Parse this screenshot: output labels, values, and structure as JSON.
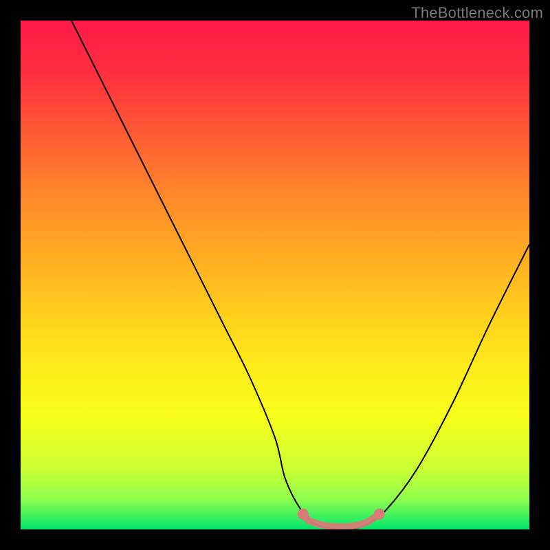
{
  "watermark": "TheBottleneck.com",
  "gradient": {
    "stops": [
      {
        "offset": 0.0,
        "color": "#ff1a47"
      },
      {
        "offset": 0.1,
        "color": "#ff2e3f"
      },
      {
        "offset": 0.22,
        "color": "#ff5a33"
      },
      {
        "offset": 0.35,
        "color": "#ff8a2a"
      },
      {
        "offset": 0.5,
        "color": "#ffb81f"
      },
      {
        "offset": 0.65,
        "color": "#ffe41a"
      },
      {
        "offset": 0.78,
        "color": "#f7ff1a"
      },
      {
        "offset": 0.88,
        "color": "#ccff33"
      },
      {
        "offset": 0.94,
        "color": "#8fff4d"
      },
      {
        "offset": 1.0,
        "color": "#00e56a"
      }
    ]
  },
  "chart_data": {
    "type": "line",
    "title": "",
    "xlabel": "",
    "ylabel": "",
    "xlim": [
      0,
      100
    ],
    "ylim": [
      0,
      100
    ],
    "series": [
      {
        "name": "curve",
        "x": [
          10,
          15,
          20,
          25,
          30,
          35,
          40,
          45,
          50,
          52,
          55,
          58,
          62,
          65,
          68,
          72,
          78,
          85,
          92,
          100
        ],
        "y": [
          100,
          90,
          80,
          70,
          60,
          50,
          40,
          30,
          18,
          10,
          4,
          1,
          0,
          0,
          1,
          4,
          12,
          25,
          40,
          56
        ]
      }
    ],
    "markers": {
      "name": "bottom-band",
      "color": "#d97b78",
      "points": [
        {
          "x": 55.5,
          "y": 3.0
        },
        {
          "x": 56.5,
          "y": 1.8
        },
        {
          "x": 58.0,
          "y": 1.2
        },
        {
          "x": 59.5,
          "y": 0.8
        },
        {
          "x": 61.0,
          "y": 0.6
        },
        {
          "x": 62.5,
          "y": 0.5
        },
        {
          "x": 64.0,
          "y": 0.5
        },
        {
          "x": 65.5,
          "y": 0.7
        },
        {
          "x": 67.0,
          "y": 1.0
        },
        {
          "x": 68.5,
          "y": 1.6
        },
        {
          "x": 70.5,
          "y": 3.0
        }
      ]
    }
  }
}
